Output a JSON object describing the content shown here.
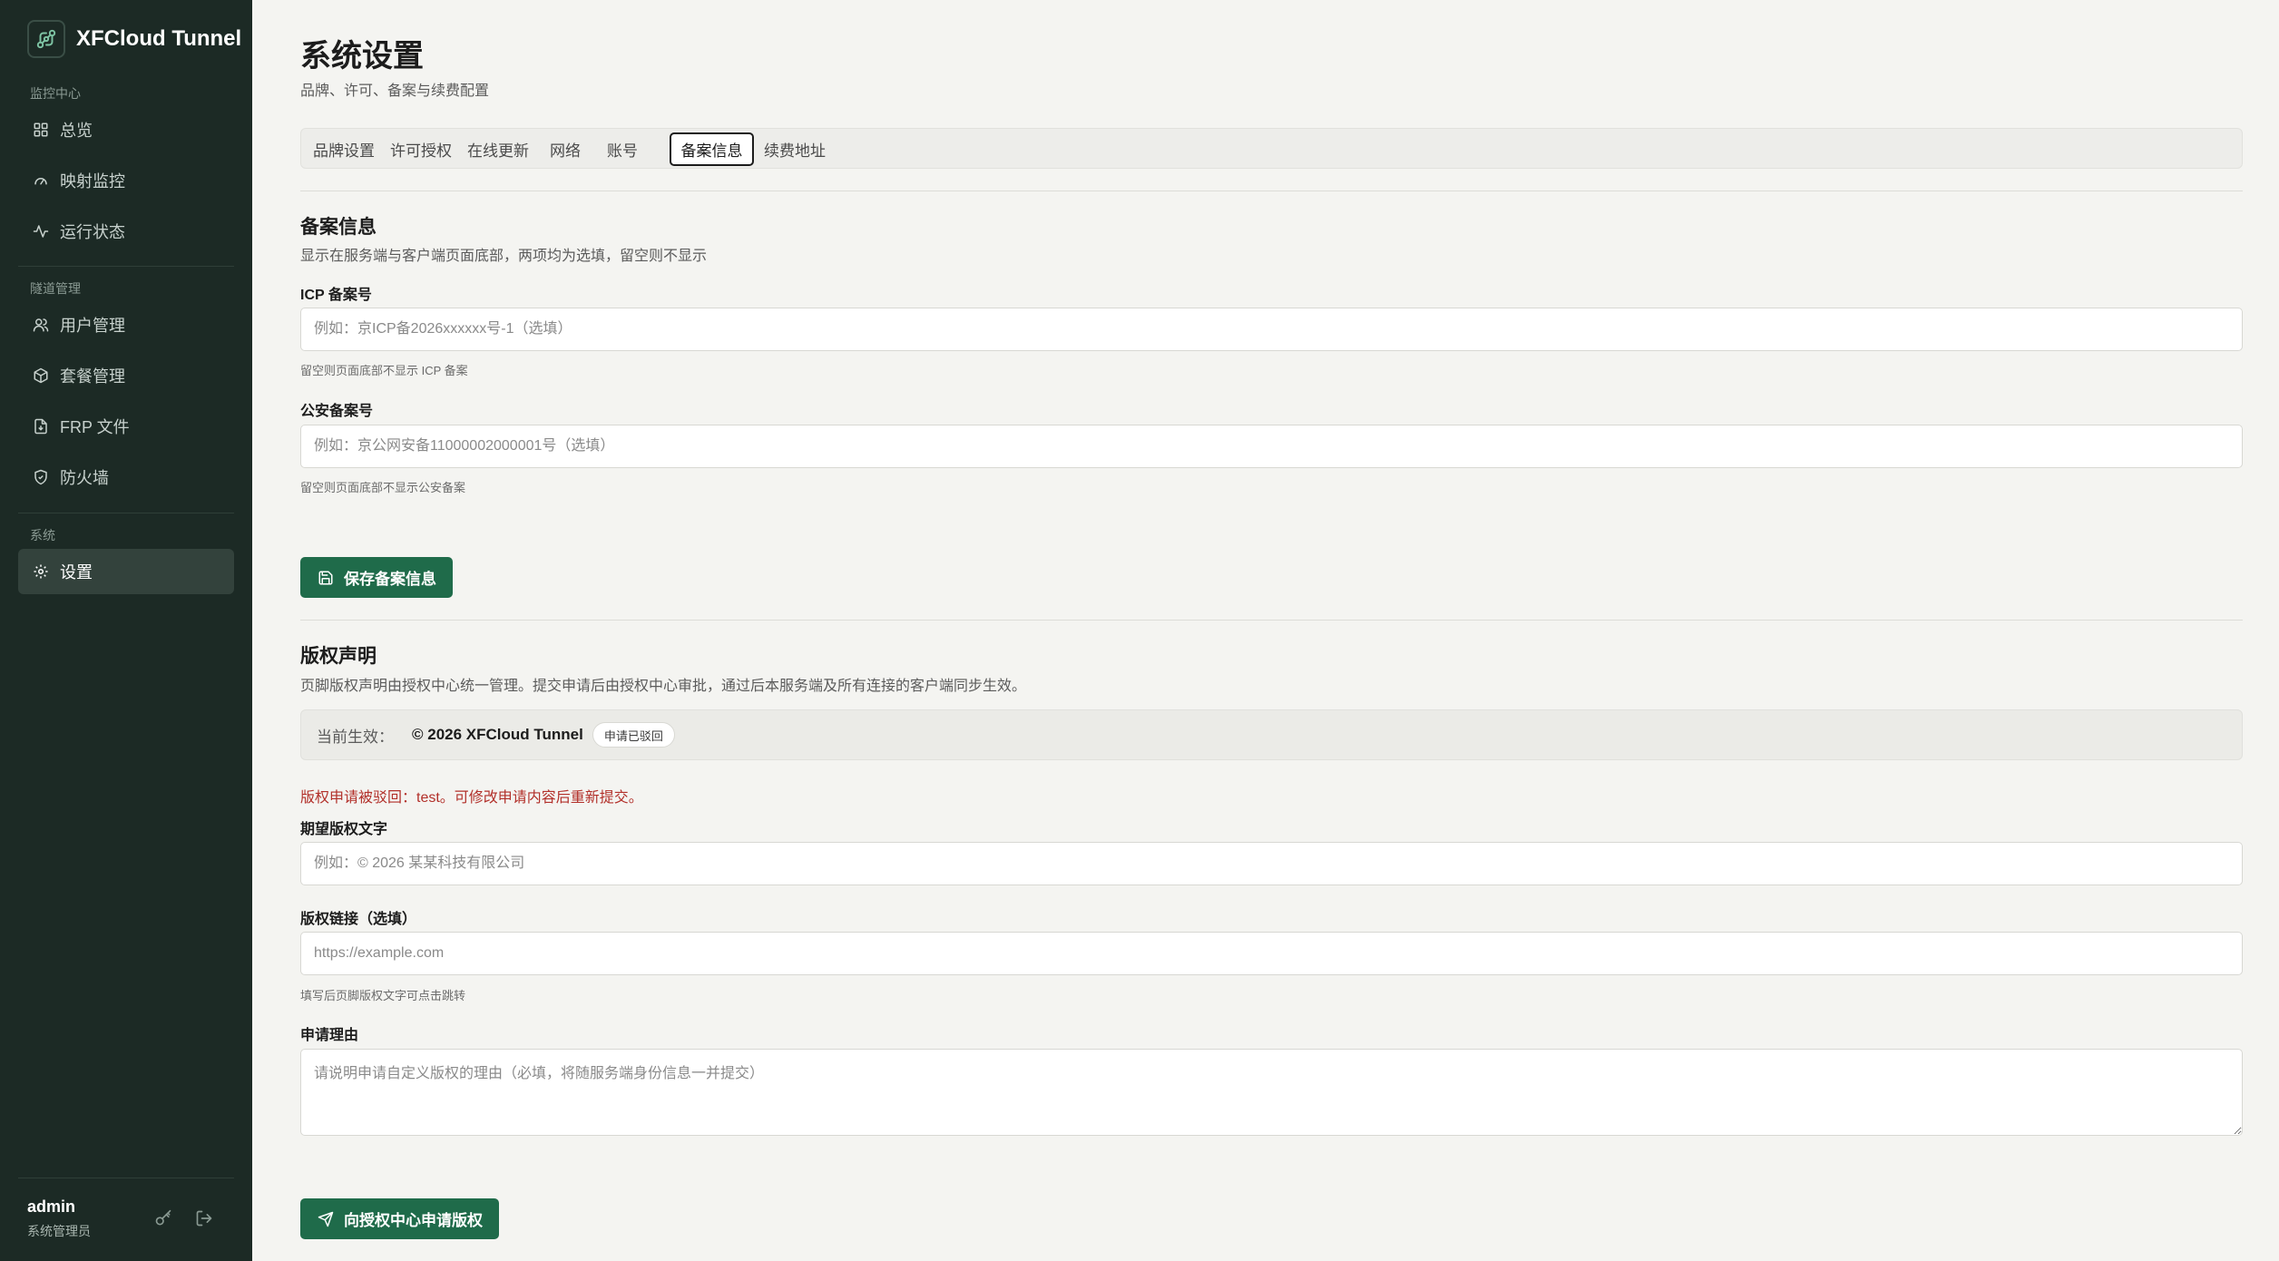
{
  "app": {
    "name": "XFCloud Tunnel"
  },
  "sidebar": {
    "sections": [
      {
        "label": "监控中心"
      },
      {
        "label": "隧道管理"
      },
      {
        "label": "系统"
      }
    ],
    "items": [
      {
        "label": "总览",
        "icon": "grid-icon"
      },
      {
        "label": "映射监控",
        "icon": "gauge-icon"
      },
      {
        "label": "运行状态",
        "icon": "activity-icon"
      },
      {
        "label": "用户管理",
        "icon": "users-icon"
      },
      {
        "label": "套餐管理",
        "icon": "package-icon"
      },
      {
        "label": "FRP 文件",
        "icon": "file-download-icon"
      },
      {
        "label": "防火墙",
        "icon": "shield-check-icon"
      },
      {
        "label": "设置",
        "icon": "gear-icon",
        "active": true
      }
    ],
    "user": {
      "name": "admin",
      "role": "系统管理员"
    }
  },
  "page": {
    "title": "系统设置",
    "subtitle": "品牌、许可、备案与续费配置"
  },
  "tabs": [
    {
      "label": "品牌设置"
    },
    {
      "label": "许可授权"
    },
    {
      "label": "在线更新"
    },
    {
      "label": "网络"
    },
    {
      "label": "账号"
    },
    {
      "label": "备案信息",
      "active": true
    },
    {
      "label": "续费地址"
    }
  ],
  "beian": {
    "title": "备案信息",
    "description": "显示在服务端与客户端页面底部，两项均为选填，留空则不显示",
    "icp_label": "ICP 备案号",
    "icp_value": "",
    "icp_placeholder": "例如：京ICP备2026xxxxxx号-1（选填）",
    "icp_hint": "留空则页面底部不显示 ICP 备案",
    "police_label": "公安备案号",
    "police_value": "",
    "police_placeholder": "例如：京公网安备11000002000001号（选填）",
    "police_hint": "留空则页面底部不显示公安备案",
    "save_button": "保存备案信息"
  },
  "copyright": {
    "title": "版权声明",
    "description": "页脚版权声明由授权中心统一管理。提交申请后由授权中心审批，通过后本服务端及所有连接的客户端同步生效。",
    "current_label": "当前生效：",
    "current_value": "© 2026 XFCloud Tunnel",
    "status_badge": "申请已驳回",
    "rejected_message": "版权申请被驳回：test。可修改申请内容后重新提交。",
    "text_label": "期望版权文字",
    "text_value": "",
    "text_placeholder": "例如：© 2026 某某科技有限公司",
    "link_label": "版权链接（选填）",
    "link_value": "",
    "link_placeholder": "https://example.com",
    "link_hint": "填写后页脚版权文字可点击跳转",
    "reason_label": "申请理由",
    "reason_value": "",
    "reason_placeholder": "请说明申请自定义版权的理由（必填，将随服务端身份信息一并提交）",
    "submit_button": "向授权中心申请版权"
  },
  "colors": {
    "sidebar_bg": "#1c2a25",
    "accent": "#1f6b4a",
    "error": "#b2302a",
    "page_bg": "#f4f4f1"
  }
}
